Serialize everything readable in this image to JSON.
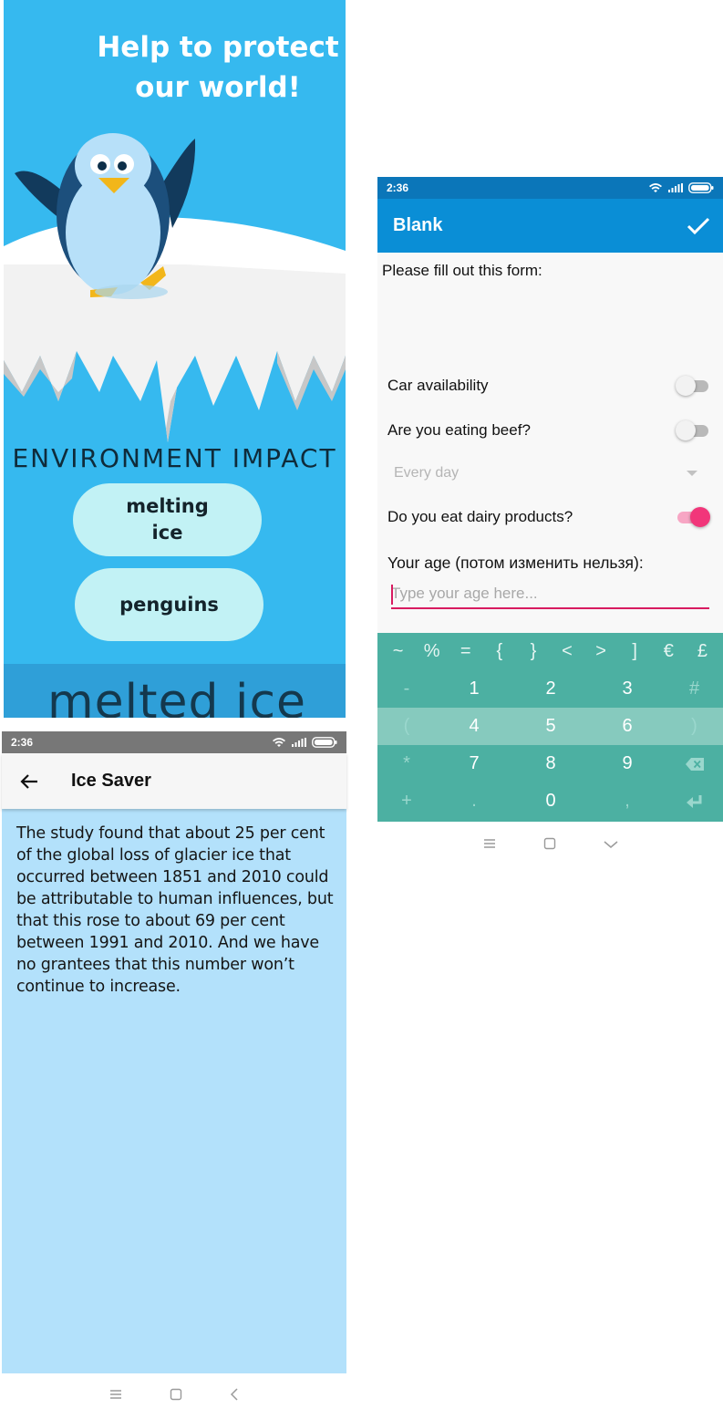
{
  "intro": {
    "headline": "Help to protect our world!",
    "section_title": "ENVIRONMENT IMPACT",
    "buttons": [
      "melting ice",
      "penguins"
    ],
    "footer_text": "melted ice",
    "colors": {
      "sky": "#36b9ef",
      "pill": "#c2f2f5",
      "penguin_body": "#1c4f7c",
      "ice": "#f2f2f2"
    }
  },
  "icesaver": {
    "status": {
      "time": "2:36"
    },
    "toolbar": {
      "title": "Ice Saver"
    },
    "body": "The study found that about 25 per cent of the global loss of glacier ice that occurred between 1851 and 2010 could be attributable to human influences, but that this rose to about 69 per cent between 1991 and 2010. And we have no grantees that this number won’t continue to increase.",
    "nav": [
      "menu-icon",
      "home-icon",
      "back-icon"
    ]
  },
  "form": {
    "status": {
      "time": "2:36"
    },
    "toolbar": {
      "title": "Blank",
      "action_icon": "check-icon"
    },
    "intro": "Please fill out this form:",
    "car": {
      "label": "Car availability",
      "checked": false
    },
    "beef": {
      "label": "Are you eating beef?",
      "checked": false
    },
    "beef_frequency": {
      "selected": "Every day"
    },
    "dairy": {
      "label": "Do you eat dairy products?",
      "checked": true
    },
    "age": {
      "label": "Your age (потом изменить нельзя):",
      "placeholder": "Type your age here..."
    },
    "keyboard": {
      "symbols": [
        "~",
        "%",
        "=",
        "{",
        "}",
        "<",
        ">",
        "]",
        "€",
        "£"
      ],
      "rows": [
        [
          "-",
          "1",
          "2",
          "3",
          "#"
        ],
        [
          "(",
          "4",
          "5",
          "6",
          ")"
        ],
        [
          "*",
          "7",
          "8",
          "9",
          "backspace-icon"
        ],
        [
          "+",
          ".",
          "0",
          ",",
          "enter-icon"
        ]
      ]
    },
    "accent": "#0a8ed6",
    "nav": [
      "menu-icon",
      "home-icon",
      "chevron-down-icon"
    ]
  }
}
